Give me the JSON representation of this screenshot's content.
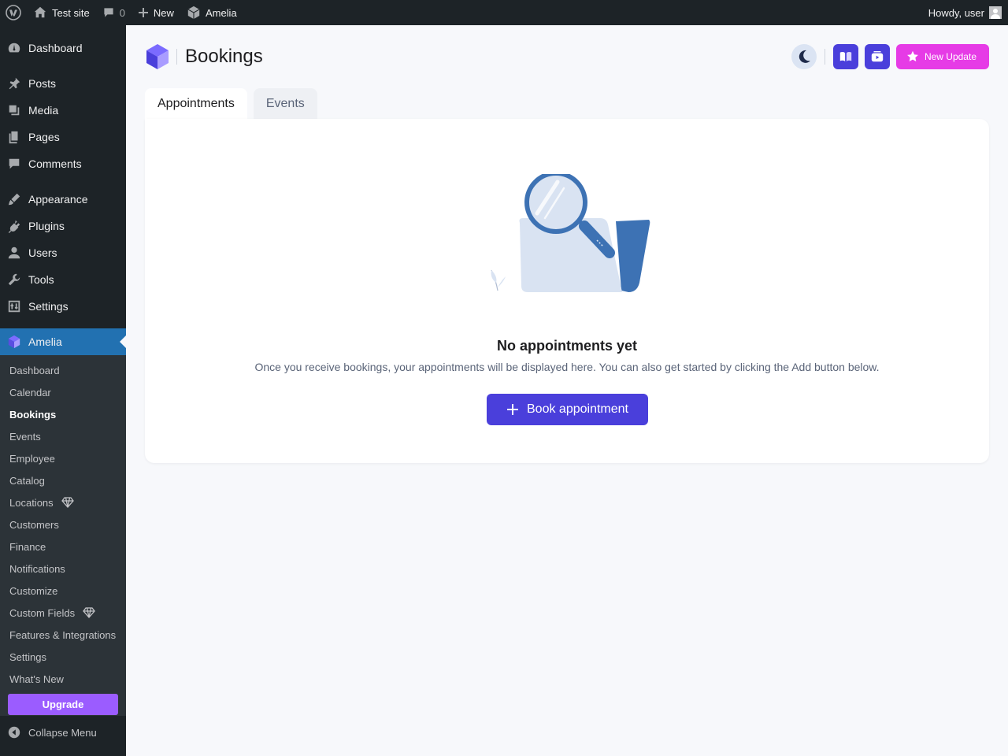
{
  "adminbar": {
    "site_name": "Test site",
    "comments_count": "0",
    "new_label": "New",
    "plugin_label": "Amelia",
    "greeting": "Howdy, user"
  },
  "sidebar": {
    "items": [
      {
        "label": "Dashboard",
        "icon": "dashboard-icon"
      },
      {
        "label": "Posts",
        "icon": "pin-icon"
      },
      {
        "label": "Media",
        "icon": "media-icon"
      },
      {
        "label": "Pages",
        "icon": "pages-icon"
      },
      {
        "label": "Comments",
        "icon": "comment-icon"
      },
      {
        "label": "Appearance",
        "icon": "brush-icon"
      },
      {
        "label": "Plugins",
        "icon": "plugin-icon"
      },
      {
        "label": "Users",
        "icon": "user-icon"
      },
      {
        "label": "Tools",
        "icon": "wrench-icon"
      },
      {
        "label": "Settings",
        "icon": "settings-icon"
      }
    ],
    "current": {
      "label": "Amelia",
      "icon": "amelia-cube-icon"
    },
    "submenu": [
      {
        "label": "Dashboard"
      },
      {
        "label": "Calendar"
      },
      {
        "label": "Bookings"
      },
      {
        "label": "Events"
      },
      {
        "label": "Employee"
      },
      {
        "label": "Catalog"
      },
      {
        "label": "Locations"
      },
      {
        "label": "Customers"
      },
      {
        "label": "Finance"
      },
      {
        "label": "Notifications"
      },
      {
        "label": "Customize"
      },
      {
        "label": "Custom Fields"
      },
      {
        "label": "Features & Integrations"
      },
      {
        "label": "Settings"
      },
      {
        "label": "What's New"
      }
    ],
    "upgrade_label": "Upgrade",
    "collapse_label": "Collapse Menu"
  },
  "header": {
    "title": "Bookings",
    "new_update_label": "New Update"
  },
  "tabs": [
    {
      "label": "Appointments",
      "active": true
    },
    {
      "label": "Events",
      "active": false
    }
  ],
  "empty_state": {
    "title": "No appointments yet",
    "description": "Once you receive bookings, your appointments will be displayed here. You can also get started by clicking the Add button below.",
    "button_label": "Book appointment"
  },
  "colors": {
    "accent": "#4a3fdb",
    "update": "#e63be6",
    "wp_dark": "#1d2327",
    "wp_current": "#2271b1",
    "upgrade": "#9b5cff"
  }
}
